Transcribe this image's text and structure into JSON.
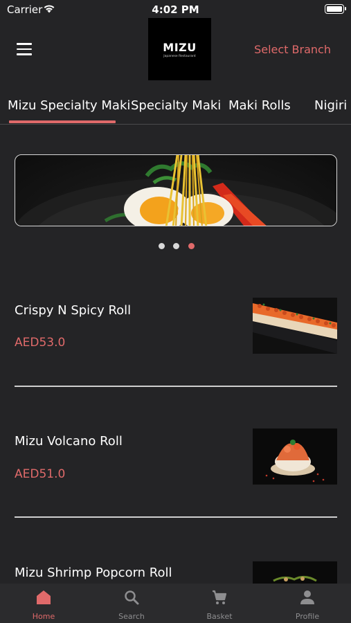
{
  "status_bar": {
    "carrier": "Carrier",
    "time": "4:02 PM"
  },
  "header": {
    "logo_text": "MIZU",
    "logo_subtext": "Japanese Restaurant",
    "select_branch": "Select Branch"
  },
  "tabs": [
    {
      "label": "Mizu Specialty Maki",
      "active": true
    },
    {
      "label": "Specialty Maki",
      "active": false
    },
    {
      "label": "Maki Rolls",
      "active": false
    },
    {
      "label": "Nigiri",
      "active": false
    }
  ],
  "carousel": {
    "slide_count": 3,
    "active_index": 2
  },
  "menu_items": [
    {
      "name": "Crispy N Spicy Roll",
      "price": "AED53.0"
    },
    {
      "name": "Mizu Volcano Roll",
      "price": "AED51.0"
    },
    {
      "name": "Mizu Shrimp Popcorn Roll",
      "price": ""
    }
  ],
  "bottom_nav": [
    {
      "label": "Home",
      "icon": "home-icon",
      "active": true
    },
    {
      "label": "Search",
      "icon": "search-icon",
      "active": false
    },
    {
      "label": "Basket",
      "icon": "cart-icon",
      "active": false
    },
    {
      "label": "Profile",
      "icon": "profile-icon",
      "active": false
    }
  ],
  "colors": {
    "accent": "#e06a6a",
    "background": "#242426",
    "nav_background": "#2b2b2d",
    "inactive_nav": "#8e8e90"
  }
}
